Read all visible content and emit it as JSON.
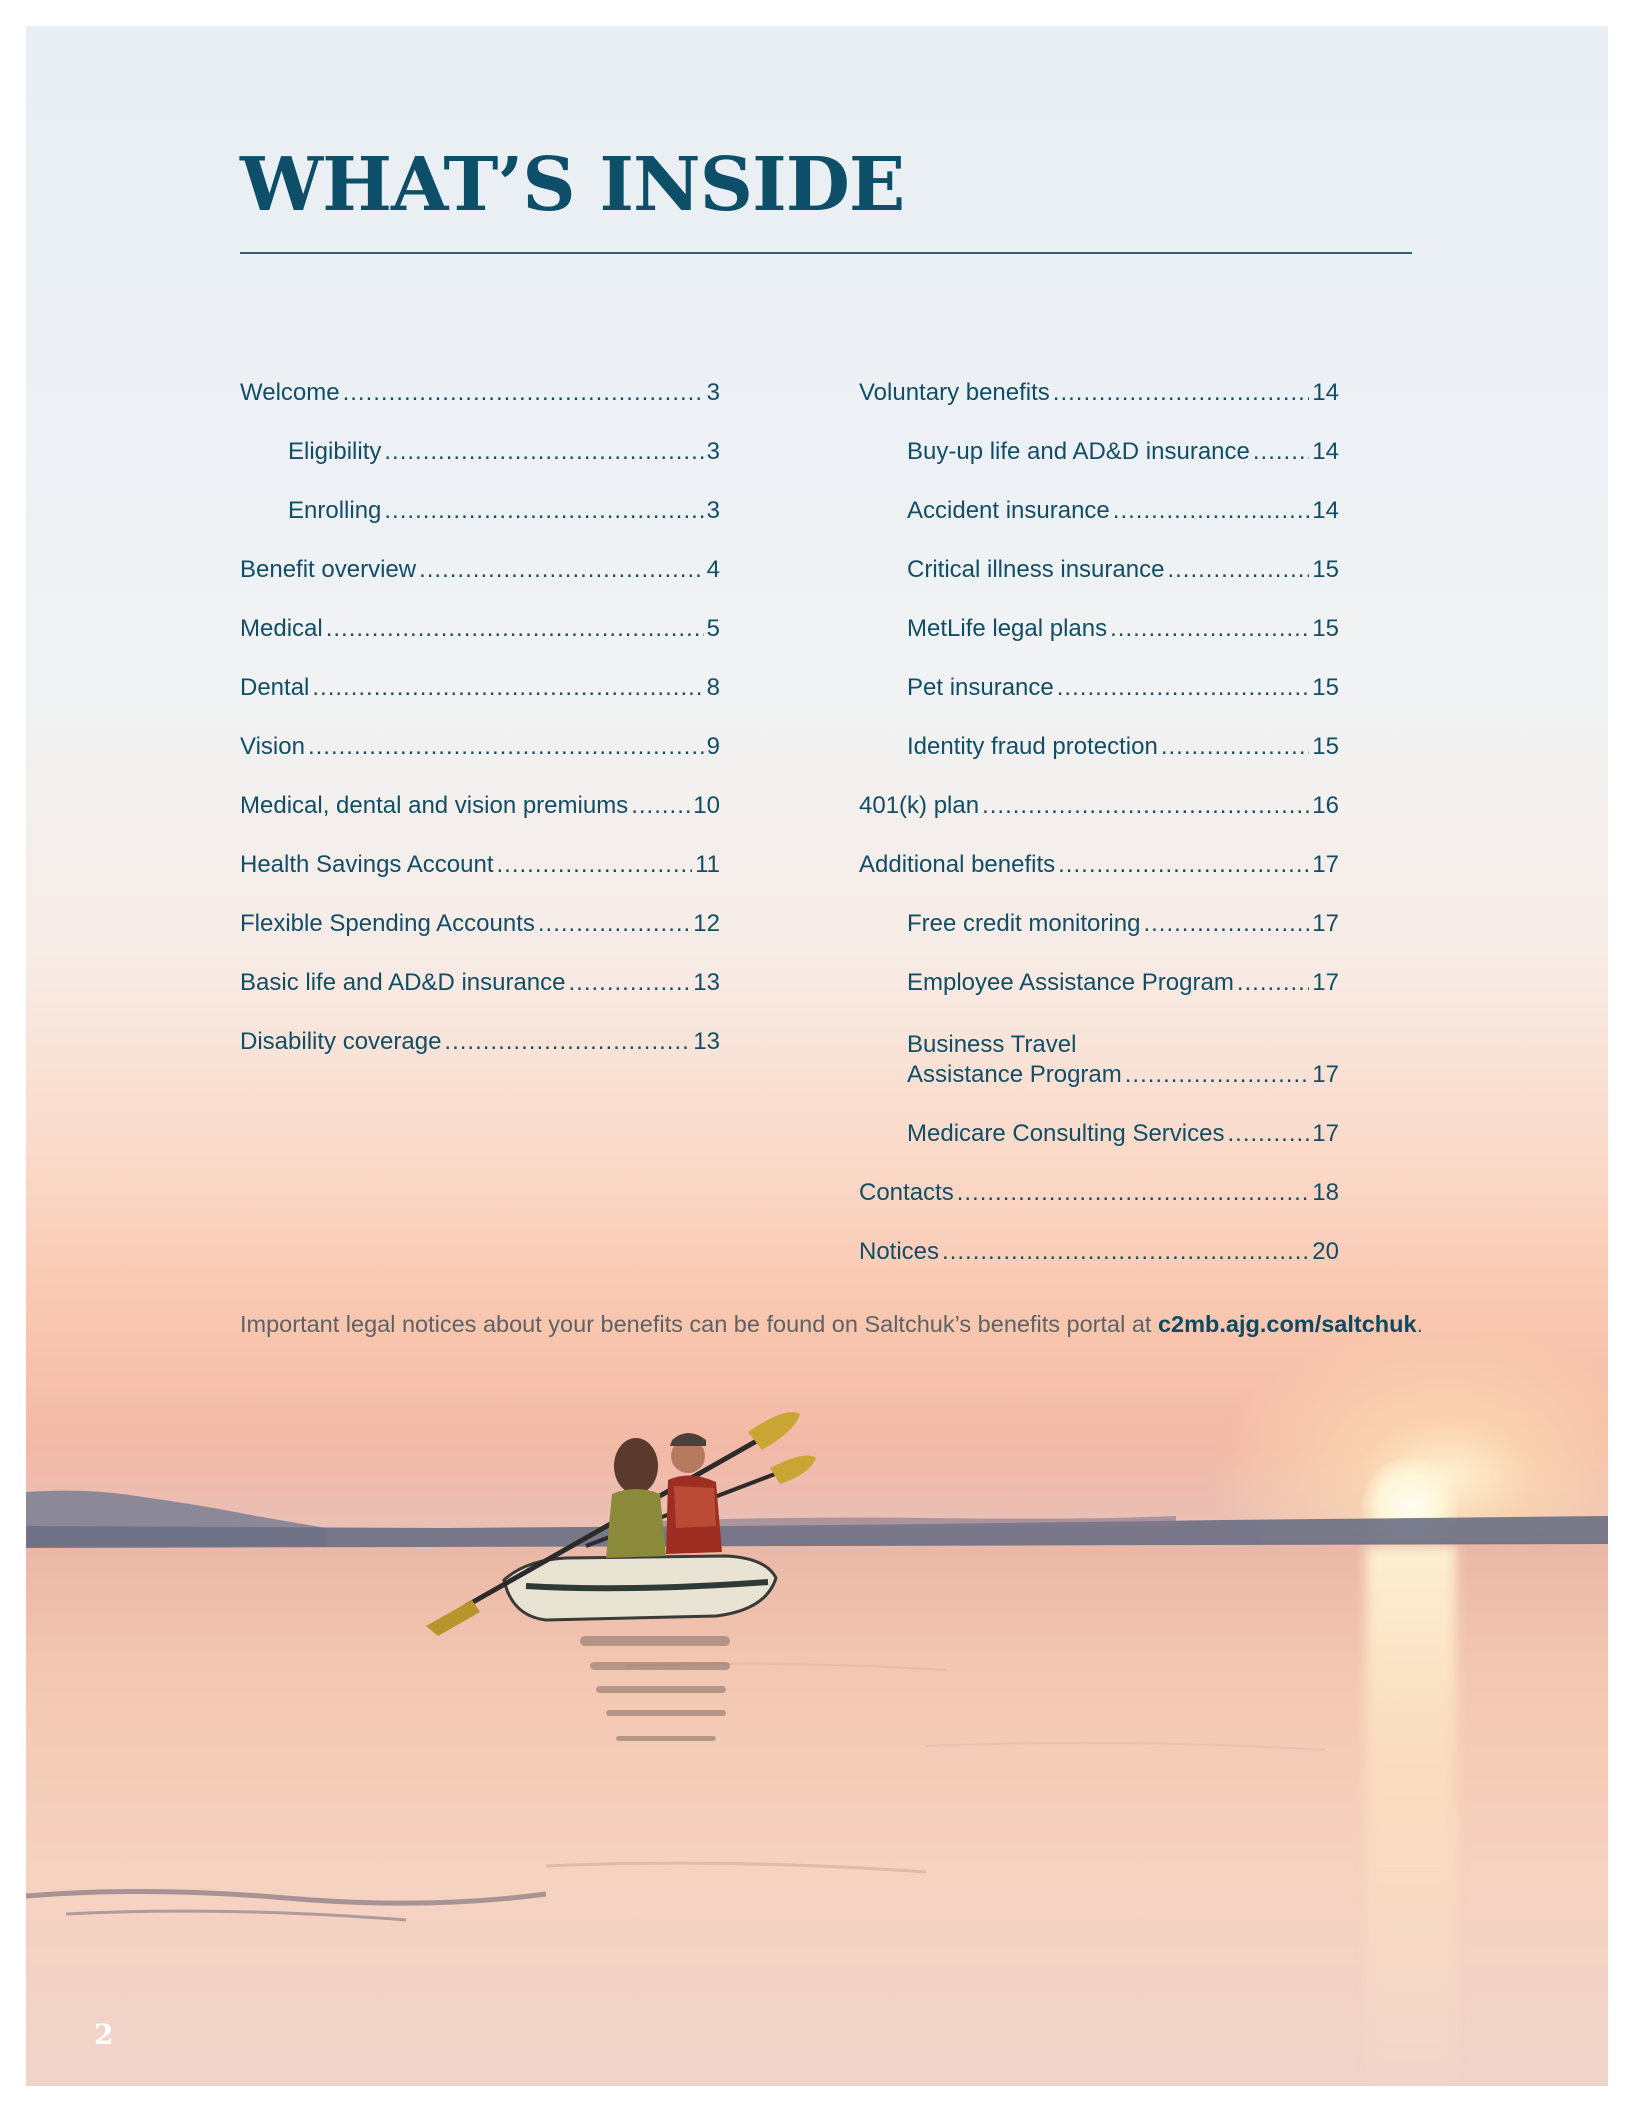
{
  "title": "WHAT’S INSIDE",
  "toc": {
    "left": [
      {
        "label": "Welcome",
        "page": "3",
        "sub": false
      },
      {
        "label": "Eligibility",
        "page": "3",
        "sub": true
      },
      {
        "label": "Enrolling",
        "page": "3",
        "sub": true
      },
      {
        "label": "Benefit overview",
        "page": "4",
        "sub": false
      },
      {
        "label": "Medical",
        "page": "5",
        "sub": false
      },
      {
        "label": "Dental",
        "page": "8",
        "sub": false
      },
      {
        "label": "Vision",
        "page": "9",
        "sub": false
      },
      {
        "label": "Medical, dental and vision premiums",
        "page": "10",
        "sub": false
      },
      {
        "label": "Health Savings Account",
        "page": "11",
        "sub": false
      },
      {
        "label": "Flexible Spending Accounts",
        "page": "12",
        "sub": false
      },
      {
        "label": "Basic life and AD&D insurance",
        "page": "13",
        "sub": false
      },
      {
        "label": "Disability coverage",
        "page": "13",
        "sub": false
      }
    ],
    "right": [
      {
        "label": "Voluntary benefits",
        "page": "14",
        "sub": false
      },
      {
        "label": "Buy-up life and AD&D insurance",
        "page": "14",
        "sub": true
      },
      {
        "label": "Accident insurance",
        "page": "14",
        "sub": true
      },
      {
        "label": "Critical illness insurance",
        "page": "15",
        "sub": true
      },
      {
        "label": "MetLife legal plans",
        "page": "15",
        "sub": true
      },
      {
        "label": "Pet insurance",
        "page": "15",
        "sub": true
      },
      {
        "label": "Identity fraud protection",
        "page": "15",
        "sub": true
      },
      {
        "label": "401(k) plan",
        "page": "16",
        "sub": false
      },
      {
        "label": "Additional benefits",
        "page": "17",
        "sub": false
      },
      {
        "label": "Free credit monitoring",
        "page": "17",
        "sub": true
      },
      {
        "label": "Employee Assistance Program",
        "page": "17",
        "sub": true
      },
      {
        "label_line1": "Business Travel",
        "label": "Assistance Program",
        "page": "17",
        "sub": true
      },
      {
        "label": "Medicare Consulting Services",
        "page": "17",
        "sub": true
      },
      {
        "label": "Contacts",
        "page": "18",
        "sub": false
      },
      {
        "label": "Notices",
        "page": "20",
        "sub": false
      }
    ]
  },
  "notice": {
    "text": "Important legal notices about your benefits can be found on Saltchuk’s benefits portal at ",
    "link": "c2mb.ajg.com/saltchuk",
    "end": "."
  },
  "page_number": "2",
  "colors": {
    "heading": "#0d4f68",
    "toc_text": "#114e66",
    "notice_text": "#5e6266"
  }
}
